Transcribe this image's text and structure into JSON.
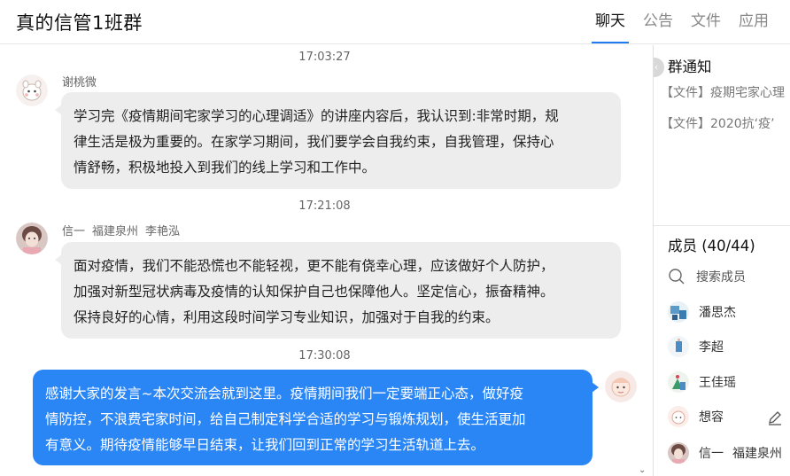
{
  "header": {
    "title": "真的信管1班群",
    "tabs": [
      {
        "label": "聊天",
        "active": true
      },
      {
        "label": "公告",
        "active": false
      },
      {
        "label": "文件",
        "active": false
      },
      {
        "label": "应用",
        "active": false
      }
    ]
  },
  "messages": [
    {
      "time": "17:03:27",
      "sender": "谢桃微",
      "text": [
        "学习完《疫情期间宅家学习的心理调适》的讲座内容后，我认识到:非常时期，规",
        "律生活是极为重要的。在家学习期间，我们要学会自我约束，自我管理，保持心",
        "情舒畅，积极地投入到我们的线上学习和工作中。"
      ]
    },
    {
      "time": "17:21:08",
      "sender_parts": [
        "信一",
        "福建泉州",
        "李艳泓"
      ],
      "text": [
        "面对疫情，我们不能恐慌也不能轻视，更不能有侥幸心理，应该做好个人防护，",
        "加强对新型冠状病毒及疫情的认知保护自己也保障他人。坚定信心，振奋精神。",
        "保持良好的心情，利用这段时间学习专业知识，加强对于自我的约束。"
      ]
    },
    {
      "time": "17:30:08",
      "outgoing": true,
      "text": [
        "感谢大家的发言~本次交流会就到这里。疫情期间我们一定要端正心态，做好疫",
        "情防控，不浪费宅家时间，给自己制定科学合适的学习与锻炼规划，使生活更加",
        "有意义。期待疫情能够早日结束，让我们回到正常的学习生活轨道上去。"
      ]
    }
  ],
  "notice": {
    "title": "群通知",
    "files": [
      "【文件】疫期宅家心理",
      "【文件】2020抗‘疫’"
    ]
  },
  "members": {
    "title": "成员 (40/44)",
    "search_label": "搜索成员",
    "list": [
      {
        "name": "潘思杰"
      },
      {
        "name": "李超"
      },
      {
        "name": "王佳瑶"
      },
      {
        "name": "想容"
      },
      {
        "name_parts": [
          "信一",
          "福建泉州"
        ]
      }
    ]
  },
  "colors": {
    "accent": "#1f7bf0",
    "outgoing_bubble": "#2b86f5",
    "incoming_bubble": "#ededed"
  },
  "icons": [
    "avatar-cartoon-icon",
    "search-icon",
    "edit-pencil-icon",
    "collapse-arrow-icon",
    "scroll-down-icon"
  ]
}
